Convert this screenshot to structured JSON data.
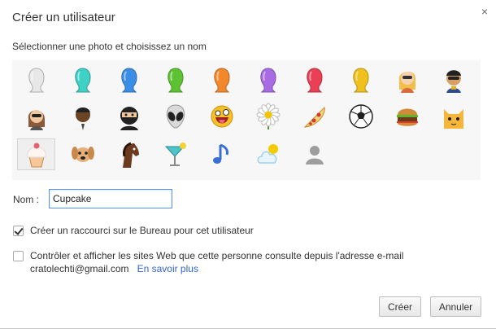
{
  "dialog": {
    "title": "Créer un utilisateur",
    "close_glyph": "×",
    "instruction": "Sélectionner une photo et choisissez un nom"
  },
  "avatars": {
    "selected_index": 20,
    "rows": [
      [
        {
          "icon": "silhouette-white-icon",
          "color": "#e8e8e8"
        },
        {
          "icon": "silhouette-teal-icon",
          "color": "#3fd0c6"
        },
        {
          "icon": "silhouette-blue-icon",
          "color": "#3a8ee6"
        },
        {
          "icon": "silhouette-green-icon",
          "color": "#5cc232"
        },
        {
          "icon": "silhouette-orange-icon",
          "color": "#f3872c"
        },
        {
          "icon": "silhouette-purple-icon",
          "color": "#a86be3"
        },
        {
          "icon": "silhouette-red-icon",
          "color": "#ea3f55"
        },
        {
          "icon": "silhouette-yellow-icon",
          "color": "#f0c11d"
        },
        {
          "icon": "blonde-woman-icon",
          "color": "#f2c04a"
        },
        {
          "icon": "sunglasses-man-icon",
          "color": "#2b4b8c"
        }
      ],
      [
        {
          "icon": "woman-sunglasses-icon",
          "color": "#8b5a3c"
        },
        {
          "icon": "dark-man-icon",
          "color": "#6b4423"
        },
        {
          "icon": "ninja-icon",
          "color": "#222222"
        },
        {
          "icon": "alien-icon",
          "color": "#d9d9d9"
        },
        {
          "icon": "smiley-icon",
          "color": "#f6c026"
        },
        {
          "icon": "daisy-icon",
          "color": "#ffffff"
        },
        {
          "icon": "pizza-icon",
          "color": "#f4b860"
        },
        {
          "icon": "soccer-ball-icon",
          "color": "#ffffff"
        },
        {
          "icon": "burger-icon",
          "color": "#b86a2a"
        },
        {
          "icon": "cat-icon",
          "color": "#f5b63b"
        }
      ],
      [
        {
          "icon": "cupcake-icon",
          "color": "#e5606e"
        },
        {
          "icon": "puppy-icon",
          "color": "#c9894a"
        },
        {
          "icon": "horse-icon",
          "color": "#6b3a1f"
        },
        {
          "icon": "cocktail-icon",
          "color": "#4fc3c9"
        },
        {
          "icon": "music-note-icon",
          "color": "#3a6fd6"
        },
        {
          "icon": "cloud-sun-icon",
          "color": "#9ed1ef"
        },
        {
          "icon": "generic-avatar-icon",
          "color": "#9e9e9e"
        }
      ]
    ]
  },
  "name_field": {
    "label": "Nom :",
    "value": "Cupcake"
  },
  "options": {
    "shortcut": {
      "label": "Créer un raccourci sur le Bureau pour cet utilisateur",
      "checked": true
    },
    "supervise": {
      "label": "Contrôler et afficher les sites Web que cette personne consulte depuis l'adresse e-mail",
      "email": "cratolechti@gmail.com",
      "link": "En savoir plus",
      "checked": false
    }
  },
  "buttons": {
    "create": "Créer",
    "cancel": "Annuler"
  }
}
